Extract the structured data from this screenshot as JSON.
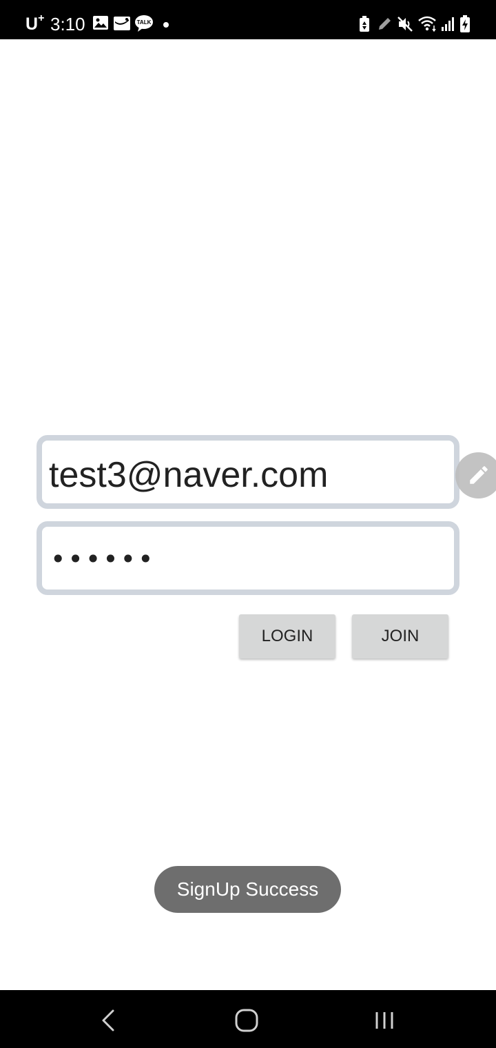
{
  "status_bar": {
    "carrier": "U",
    "carrier_sup": "+",
    "time": "3:10",
    "left_icons": [
      "image-icon",
      "mail-icon",
      "talk-icon",
      "dot-icon"
    ],
    "talk_label": "TALK",
    "right_icons": [
      "battery-saver-icon",
      "pen-icon",
      "mute-icon",
      "wifi-icon",
      "signal-icon",
      "battery-charging-icon"
    ]
  },
  "login_form": {
    "email_value": "test3@naver.com",
    "password_value": "••••••",
    "login_label": "LOGIN",
    "join_label": "JOIN"
  },
  "toast": {
    "message": "SignUp Success"
  },
  "nav_bar": {
    "icons": [
      "back-icon",
      "home-icon",
      "recents-icon"
    ]
  },
  "colors": {
    "status_bar": "#000000",
    "field_border": "#cfd5dd",
    "button_bg": "#d6d7d7",
    "toast_bg": "#6e6e6e",
    "fab_bg": "#bdbdbd"
  }
}
